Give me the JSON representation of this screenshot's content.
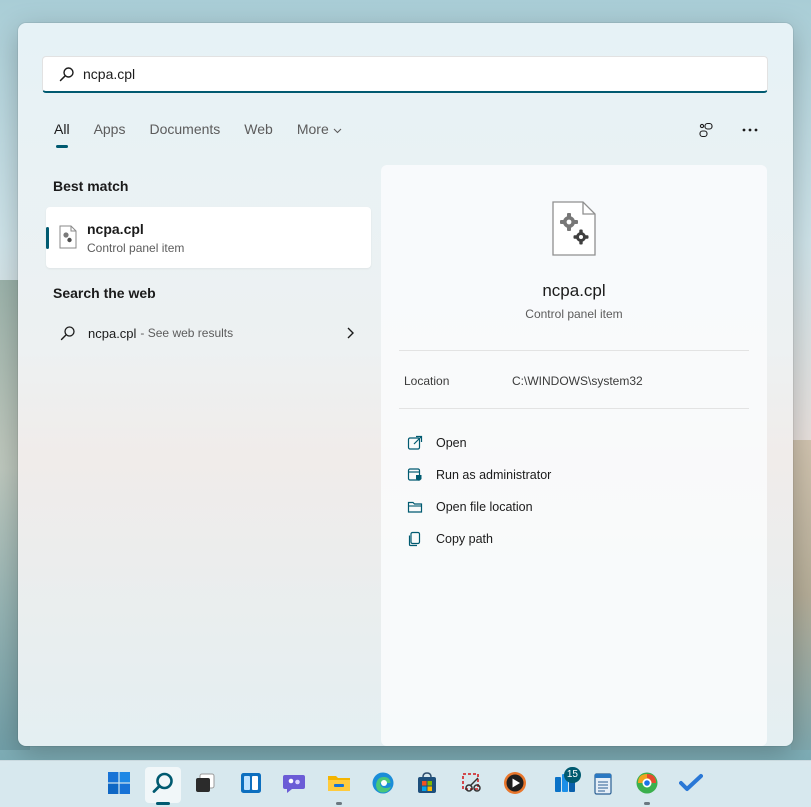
{
  "search": {
    "query": "ncpa.cpl",
    "icon": "search-icon"
  },
  "tabs": [
    {
      "label": "All",
      "active": true
    },
    {
      "label": "Apps",
      "active": false
    },
    {
      "label": "Documents",
      "active": false
    },
    {
      "label": "Web",
      "active": false
    },
    {
      "label": "More",
      "active": false,
      "has_dropdown": true
    }
  ],
  "top_icons": [
    "share-network-icon",
    "more-options-icon"
  ],
  "best_match": {
    "heading": "Best match",
    "item": {
      "name": "ncpa.cpl",
      "type": "Control panel item",
      "icon": "settings-file-icon"
    }
  },
  "web_search": {
    "heading": "Search the web",
    "query": "ncpa.cpl",
    "hint": "- See web results"
  },
  "preview": {
    "name": "ncpa.cpl",
    "type": "Control panel item",
    "location_label": "Location",
    "location_value": "C:\\WINDOWS\\system32",
    "actions": [
      {
        "label": "Open",
        "icon": "open-external-icon"
      },
      {
        "label": "Run as administrator",
        "icon": "shield-admin-icon"
      },
      {
        "label": "Open file location",
        "icon": "folder-icon"
      },
      {
        "label": "Copy path",
        "icon": "copy-icon"
      }
    ]
  },
  "taskbar": {
    "items": [
      {
        "name": "start",
        "icon": "windows-logo-icon"
      },
      {
        "name": "search",
        "icon": "search-icon",
        "active": true
      },
      {
        "name": "task-view",
        "icon": "task-view-icon"
      },
      {
        "name": "widgets",
        "icon": "widgets-icon"
      },
      {
        "name": "chat",
        "icon": "chat-icon"
      },
      {
        "name": "file-explorer",
        "icon": "folder-icon",
        "running": true
      },
      {
        "name": "edge",
        "icon": "edge-icon"
      },
      {
        "name": "store",
        "icon": "store-icon"
      },
      {
        "name": "snipping-tool",
        "icon": "snipping-icon"
      },
      {
        "name": "media-player",
        "icon": "media-player-icon"
      },
      {
        "name": "news",
        "icon": "news-icon",
        "badge": "15"
      },
      {
        "name": "notepad",
        "icon": "notepad-icon"
      },
      {
        "name": "edge-beta",
        "icon": "edge-beta-icon",
        "running": true
      },
      {
        "name": "todo",
        "icon": "todo-check-icon"
      }
    ]
  },
  "colors": {
    "accent": "#005a70",
    "panel_bg": "#edf1f2",
    "text_secondary": "#5c5c5c"
  }
}
